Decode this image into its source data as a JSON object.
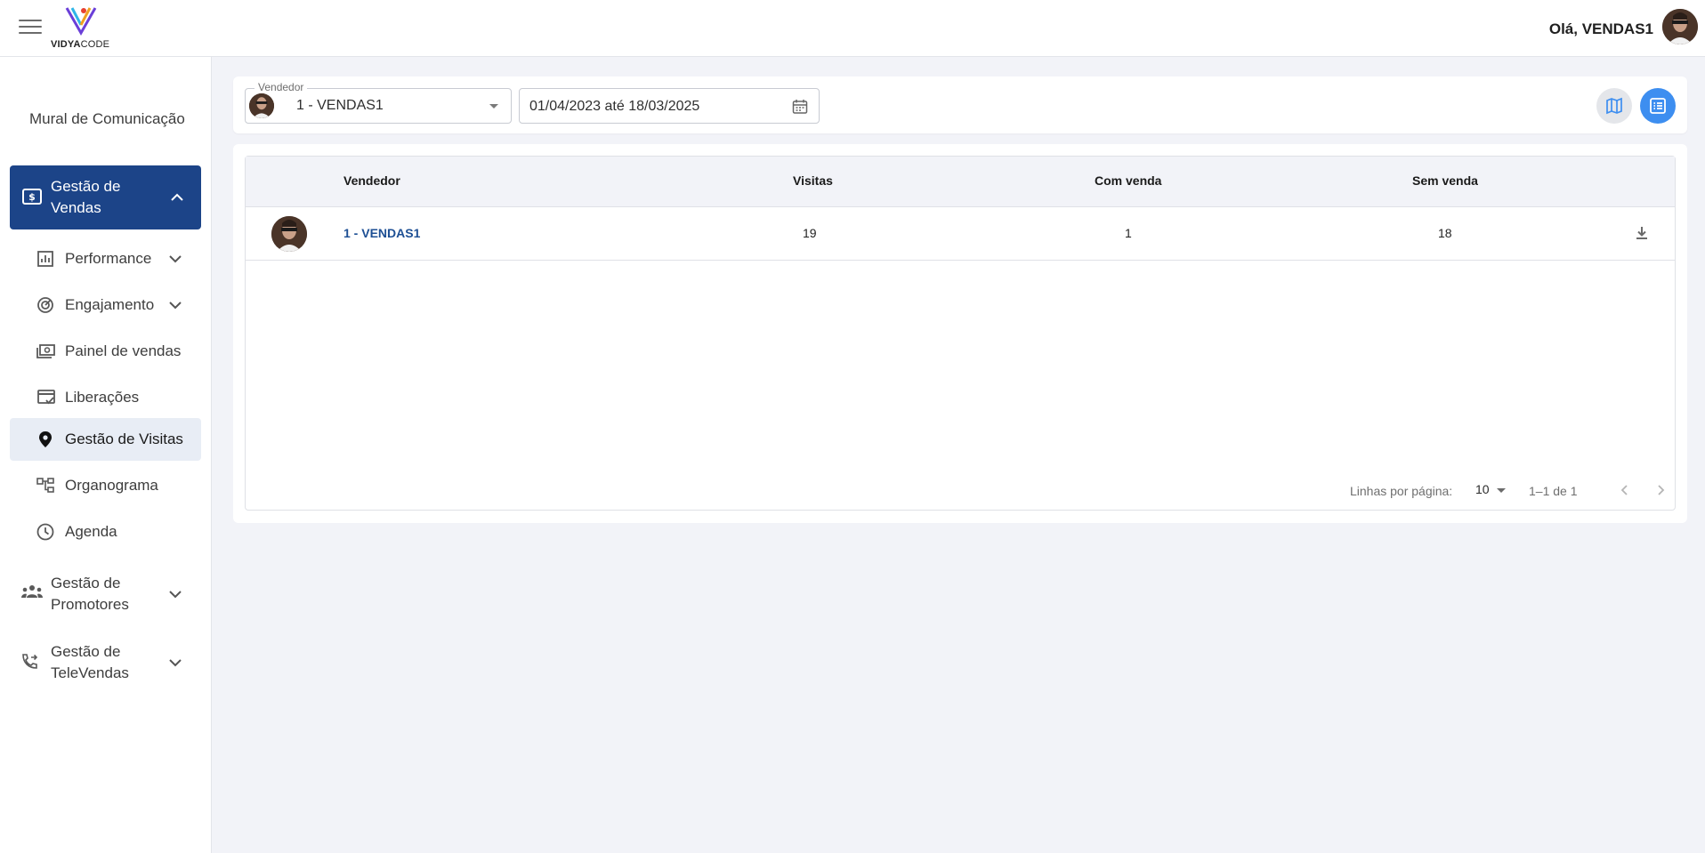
{
  "header": {
    "logo_text_bold": "VIDYA",
    "logo_text_light": "CODE",
    "greeting": "Olá, VENDAS1",
    "menu_icon": "hamburger-menu-icon"
  },
  "sidebar": {
    "mural": "Mural de Comunicação",
    "sales_group": "Gestão de Vendas",
    "sales_items": [
      {
        "label": "Performance",
        "icon": "bar-chart-icon",
        "expandable": true
      },
      {
        "label": "Engajamento",
        "icon": "target-icon",
        "expandable": true
      },
      {
        "label": "Painel de vendas",
        "icon": "money-panel-icon",
        "expandable": false
      },
      {
        "label": "Liberações",
        "icon": "card-check-icon",
        "expandable": false
      },
      {
        "label": "Gestão de Visitas",
        "icon": "location-pin-icon",
        "expandable": false,
        "active": true
      },
      {
        "label": "Organograma",
        "icon": "org-chart-icon",
        "expandable": false
      },
      {
        "label": "Agenda",
        "icon": "clock-icon",
        "expandable": false
      }
    ],
    "promoters_group": "Gestão de Promotores",
    "televendas_group": "Gestão de TeleVendas"
  },
  "filters": {
    "seller_label": "Vendedor",
    "seller_value": "1 - VENDAS1",
    "date_range": "01/04/2023 até 18/03/2025"
  },
  "table": {
    "columns": [
      "Vendedor",
      "Visitas",
      "Com venda",
      "Sem venda"
    ],
    "rows": [
      {
        "vendedor": "1 - VENDAS1",
        "visitas": "19",
        "com_venda": "1",
        "sem_venda": "18"
      }
    ],
    "pagination": {
      "rows_per_page_label": "Linhas por página:",
      "rows_per_page": "10",
      "range": "1–1 de 1"
    }
  },
  "colors": {
    "primary_dark": "#1c4488",
    "accent_blue": "#3d8ef0",
    "link_blue": "#1d4f94",
    "background": "#f2f3f8"
  }
}
